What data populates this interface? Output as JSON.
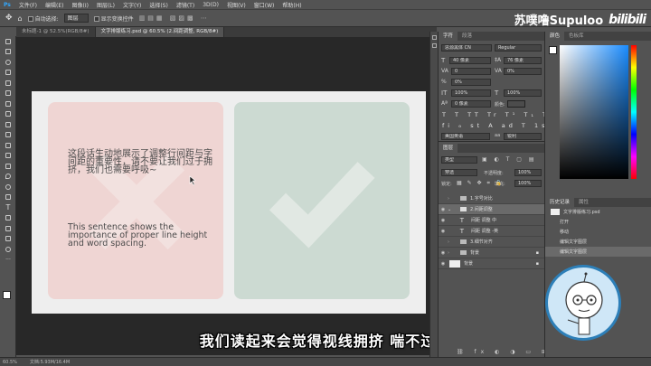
{
  "menubar": {
    "items": [
      "文件(F)",
      "编辑(E)",
      "图像(I)",
      "图层(L)",
      "文字(Y)",
      "选择(S)",
      "滤镜(T)",
      "3D(D)",
      "视图(V)",
      "窗口(W)",
      "帮助(H)"
    ]
  },
  "options": {
    "auto_select": "自动选择:",
    "auto_select_value": "图层",
    "transform": "显示变换控件"
  },
  "watermark": {
    "text": "苏噗噜Supuloo",
    "logo": "bilibili"
  },
  "tabs": [
    "未标题-1 @ 52.5%(RGB/8#)",
    "文字排版练习.psd @ 60.5% (2.间距调整, RGB/8#)"
  ],
  "canvas": {
    "cn_text": "这段话生动地展示了调整行间距与字间距的重要性，请不要让我们过于拥挤，我们也需要呼吸~",
    "en_text": "This sentence shows the importance of proper line height and word spacing."
  },
  "subtitle": "我们读起来会觉得视线拥挤 喘不过气",
  "status": {
    "zoom": "60.5%",
    "doc": "文档:5.93M/16.4M"
  },
  "char_panel": {
    "tabs": [
      "字符",
      "段落"
    ],
    "font_family": "思源黑体 CN",
    "font_style": "Regular",
    "size": "40 像素",
    "leading": "76 像素",
    "kerning": "0",
    "tracking": "0%",
    "vscale": "100%",
    "hscale": "100%",
    "baseline": "0 像素",
    "color_label": "颜色:",
    "language": "美国英语",
    "aa": "锐利"
  },
  "layers_panel": {
    "tabs": [
      "图层"
    ],
    "filter": "类型",
    "blend": "穿透",
    "opacity_label": "不透明度:",
    "opacity": "100%",
    "lock_label": "锁定:",
    "fill_label": "填充:",
    "fill": "100%",
    "rows": [
      {
        "name": "1.字号对比",
        "type": "folder",
        "visible": false,
        "indent": 1
      },
      {
        "name": "2.间距调整",
        "type": "folder",
        "visible": true,
        "indent": 1,
        "selected": true
      },
      {
        "name": "间距 调整 中",
        "type": "text",
        "visible": true,
        "indent": 2
      },
      {
        "name": "间距 调整 -英",
        "type": "text",
        "visible": true,
        "indent": 2
      },
      {
        "name": "3.细节对齐",
        "type": "folder",
        "visible": false,
        "indent": 1
      },
      {
        "name": "背景",
        "type": "folder",
        "visible": true,
        "indent": 1
      },
      {
        "name": "背景",
        "type": "layer",
        "visible": true,
        "indent": 1
      }
    ]
  },
  "color_panel": {
    "tabs": [
      "颜色",
      "色板库"
    ]
  },
  "history_panel": {
    "tabs": [
      "历史记录",
      "属性"
    ],
    "snapshot": "文字排版练习.psd",
    "items": [
      "打开",
      "移动",
      "编辑文字图层",
      "编辑文字图层"
    ]
  },
  "colors": {
    "pink_card": "#efd5d3",
    "green_card": "#ccdad2",
    "artboard": "#eeeeee"
  }
}
